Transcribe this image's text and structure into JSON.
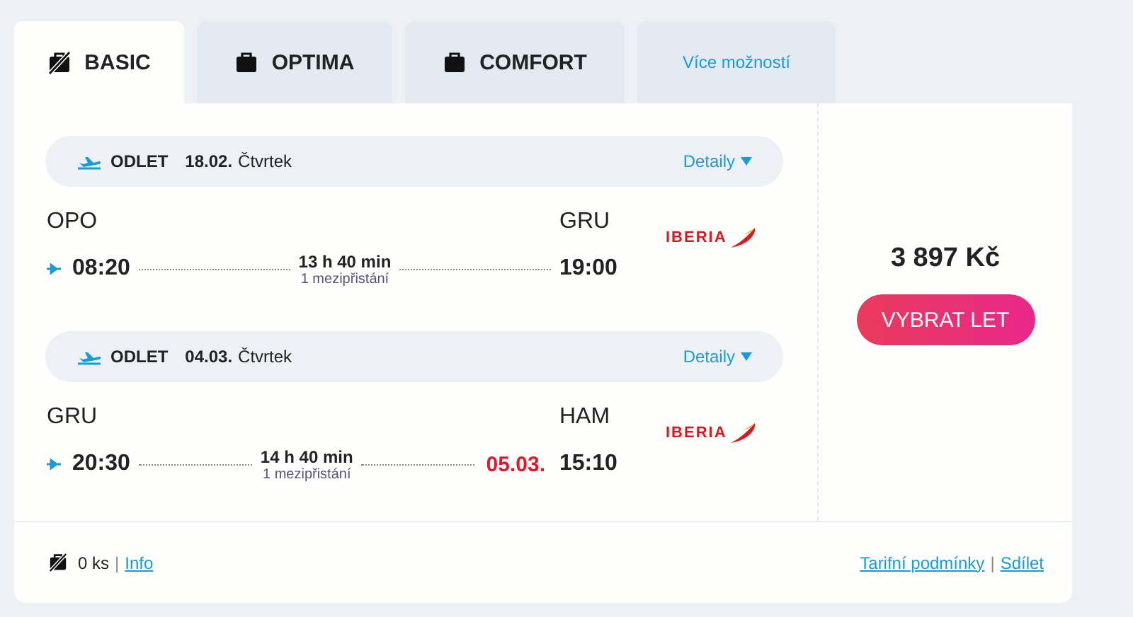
{
  "tabs": [
    {
      "kind": "basic",
      "label": "BASIC",
      "selected": true
    },
    {
      "kind": "fare",
      "label": "OPTIMA",
      "selected": false
    },
    {
      "kind": "fare",
      "label": "COMFORT",
      "selected": false
    },
    {
      "kind": "more",
      "label": "Více možností",
      "selected": false
    }
  ],
  "segments": [
    {
      "label": "ODLET",
      "date": "18.02.",
      "day": "Čtvrtek",
      "details": "Detaily",
      "from": "OPO",
      "to": "GRU",
      "departure": "08:20",
      "arrival": "19:00",
      "duration": "13 h 40 min",
      "stops": "1 mezipřistání",
      "airline": "IBERIA"
    },
    {
      "label": "ODLET",
      "date": "04.03.",
      "day": "Čtvrtek",
      "details": "Detaily",
      "from": "GRU",
      "to": "HAM",
      "departure": "20:30",
      "arrival": "15:10",
      "arrival_date": "05.03.",
      "duration": "14 h 40 min",
      "stops": "1 mezipřistání",
      "airline": "IBERIA"
    }
  ],
  "price": "3 897 Kč",
  "select_button": "VYBRAT LET",
  "footer": {
    "baggage": "0 ks",
    "separator_left": "|",
    "info_link": "Info",
    "conditions_link": "Tarifní podmínky",
    "separator_right": "|",
    "share_link": "Sdílet"
  }
}
